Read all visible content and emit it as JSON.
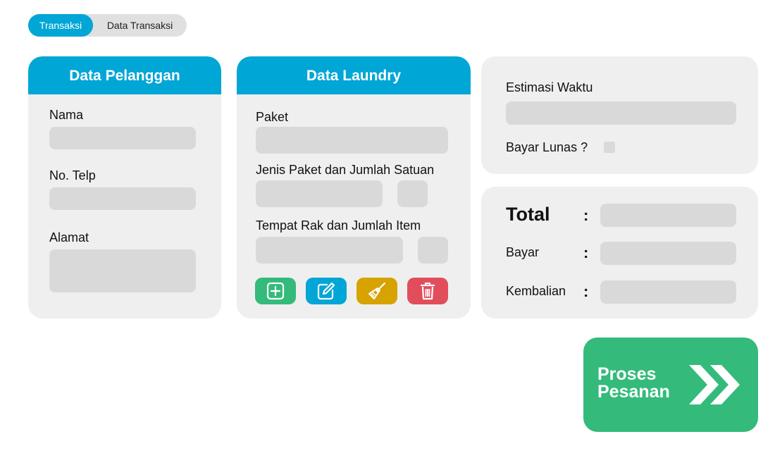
{
  "tabs": [
    {
      "label": "Transaksi"
    },
    {
      "label": "Data Transaksi"
    }
  ],
  "pelanggan": {
    "title": "Data Pelanggan",
    "nama_label": "Nama",
    "telp_label": "No. Telp",
    "alamat_label": "Alamat"
  },
  "laundry": {
    "title": "Data Laundry",
    "paket_label": "Paket",
    "jenis_label": "Jenis Paket dan Jumlah Satuan",
    "rak_label": "Tempat Rak dan Jumlah Item",
    "icons": [
      "plus-square-icon",
      "edit-icon",
      "broom-icon",
      "trash-icon"
    ]
  },
  "estimasi": {
    "waktu_label": "Estimasi Waktu",
    "lunas_label": "Bayar Lunas ?"
  },
  "summary": {
    "total_label": "Total",
    "bayar_label": "Bayar",
    "kembalian_label": "Kembalian",
    "colon": ":"
  },
  "proses": {
    "line1": "Proses",
    "line2": "Pesanan",
    "icon": "double-chevron-right-icon"
  },
  "colors": {
    "accent": "#00a6d6",
    "green": "#34bb7b",
    "yellow": "#d6a300",
    "red": "#e24d5c",
    "card_bg": "#efefef",
    "field_bg": "#d9d9d9"
  }
}
